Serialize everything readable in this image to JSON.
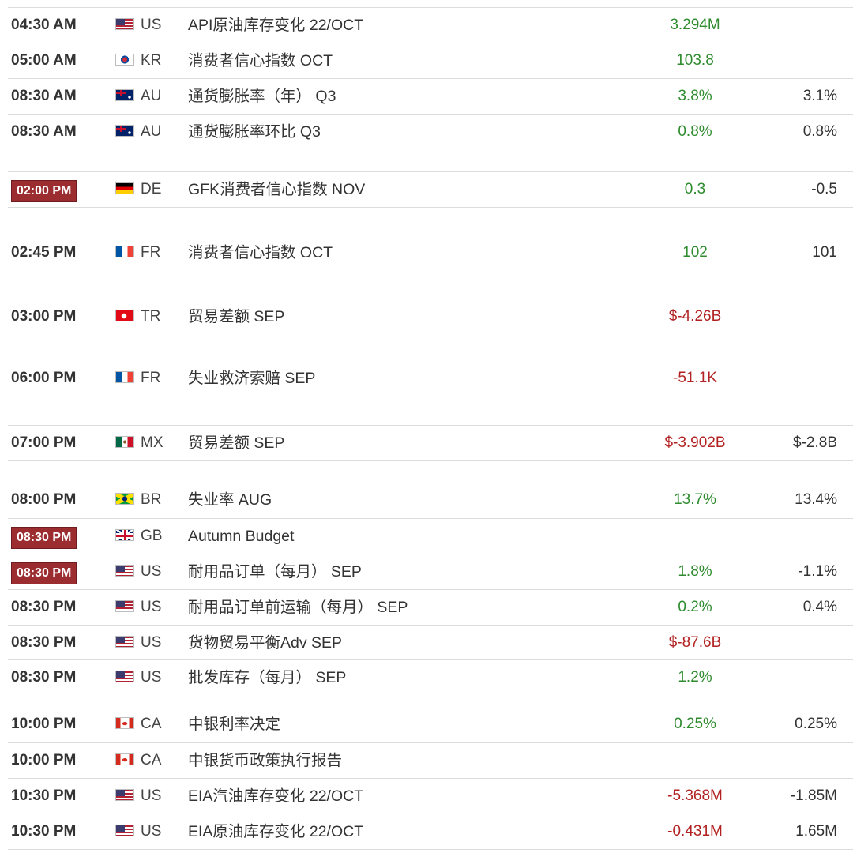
{
  "events": [
    {
      "time": "04:30 AM",
      "highlight": false,
      "country": "US",
      "flag": "us-flag-icon",
      "event": "API原油库存变化 22/OCT",
      "actual": "3.294M",
      "actual_color": "#2e8b2e",
      "previous": ""
    },
    {
      "time": "05:00 AM",
      "highlight": false,
      "country": "KR",
      "flag": "kr-flag-icon",
      "event": "消费者信心指数 OCT",
      "actual": "103.8",
      "actual_color": "#2e8b2e",
      "previous": ""
    },
    {
      "time": "08:30 AM",
      "highlight": false,
      "country": "AU",
      "flag": "au-flag-icon",
      "event": "通货膨胀率（年） Q3",
      "actual": "3.8%",
      "actual_color": "#2e8b2e",
      "previous": "3.1%"
    },
    {
      "time": "08:30 AM",
      "highlight": false,
      "country": "AU",
      "flag": "au-flag-icon",
      "event": "通货膨胀率环比 Q3",
      "actual": "0.8%",
      "actual_color": "#2e8b2e",
      "previous": "0.8%"
    },
    {
      "time": "02:00 PM",
      "highlight": true,
      "country": "DE",
      "flag": "de-flag-icon",
      "event": "GFK消费者信心指数 NOV",
      "actual": "0.3",
      "actual_color": "#2e8b2e",
      "previous": "-0.5"
    },
    {
      "time": "02:45 PM",
      "highlight": false,
      "country": "FR",
      "flag": "fr-flag-icon",
      "event": "消费者信心指数 OCT",
      "actual": "102",
      "actual_color": "#2e8b2e",
      "previous": "101"
    },
    {
      "time": "03:00 PM",
      "highlight": false,
      "country": "TR",
      "flag": "tr-flag-icon",
      "event": "贸易差额 SEP",
      "actual": "$-4.26B",
      "actual_color": "#b22222",
      "previous": ""
    },
    {
      "time": "06:00 PM",
      "highlight": false,
      "country": "FR",
      "flag": "fr-flag-icon",
      "event": "失业救济索赔 SEP",
      "actual": "-51.1K",
      "actual_color": "#b22222",
      "previous": ""
    },
    {
      "time": "07:00 PM",
      "highlight": false,
      "country": "MX",
      "flag": "mx-flag-icon",
      "event": "贸易差额 SEP",
      "actual": "$-3.902B",
      "actual_color": "#b22222",
      "previous": "$-2.8B"
    },
    {
      "time": "08:00 PM",
      "highlight": false,
      "country": "BR",
      "flag": "br-flag-icon",
      "event": "失业率 AUG",
      "actual": "13.7%",
      "actual_color": "#2e8b2e",
      "previous": "13.4%"
    },
    {
      "time": "08:30 PM",
      "highlight": true,
      "country": "GB",
      "flag": "gb-flag-icon",
      "event": "Autumn Budget",
      "actual": "",
      "actual_color": "#2e8b2e",
      "previous": ""
    },
    {
      "time": "08:30 PM",
      "highlight": true,
      "country": "US",
      "flag": "us-flag-icon",
      "event": "耐用品订单（每月） SEP",
      "actual": "1.8%",
      "actual_color": "#2e8b2e",
      "previous": "-1.1%"
    },
    {
      "time": "08:30 PM",
      "highlight": false,
      "country": "US",
      "flag": "us-flag-icon",
      "event": "耐用品订单前运输（每月） SEP",
      "actual": "0.2%",
      "actual_color": "#2e8b2e",
      "previous": "0.4%"
    },
    {
      "time": "08:30 PM",
      "highlight": false,
      "country": "US",
      "flag": "us-flag-icon",
      "event": "货物贸易平衡Adv SEP",
      "actual": "$-87.6B",
      "actual_color": "#b22222",
      "previous": ""
    },
    {
      "time": "08:30 PM",
      "highlight": false,
      "country": "US",
      "flag": "us-flag-icon",
      "event": "批发库存（每月） SEP",
      "actual": "1.2%",
      "actual_color": "#2e8b2e",
      "previous": ""
    },
    {
      "time": "10:00 PM",
      "highlight": false,
      "country": "CA",
      "flag": "ca-flag-icon",
      "event": "中银利率决定",
      "actual": "0.25%",
      "actual_color": "#2e8b2e",
      "previous": "0.25%"
    },
    {
      "time": "10:00 PM",
      "highlight": false,
      "country": "CA",
      "flag": "ca-flag-icon",
      "event": "中银货币政策执行报告",
      "actual": "",
      "actual_color": "#2e8b2e",
      "previous": ""
    },
    {
      "time": "10:30 PM",
      "highlight": false,
      "country": "US",
      "flag": "us-flag-icon",
      "event": "EIA汽油库存变化 22/OCT",
      "actual": "-5.368M",
      "actual_color": "#b22222",
      "previous": "-1.85M"
    },
    {
      "time": "10:30 PM",
      "highlight": false,
      "country": "US",
      "flag": "us-flag-icon",
      "event": "EIA原油库存变化 22/OCT",
      "actual": "-0.431M",
      "actual_color": "#b22222",
      "previous": "1.65M"
    }
  ]
}
